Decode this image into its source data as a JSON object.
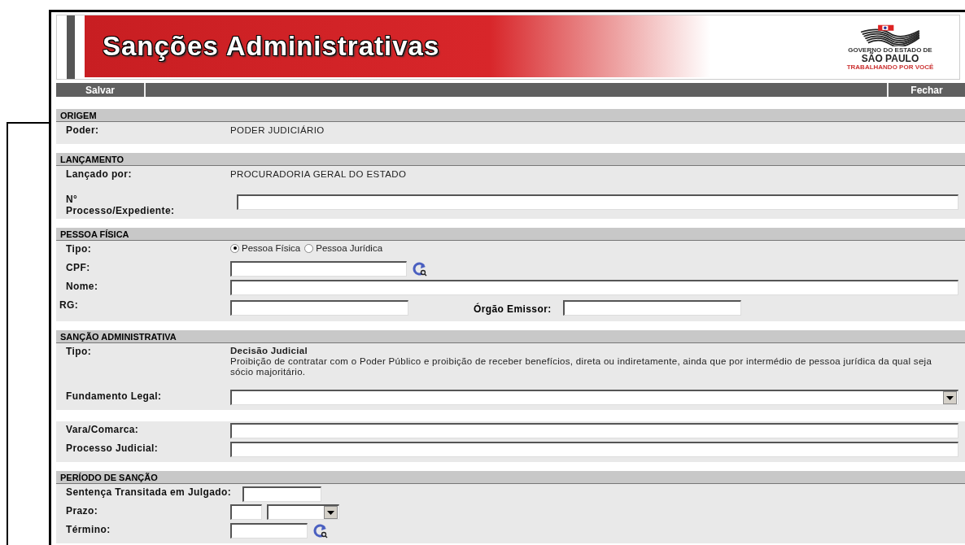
{
  "header": {
    "title": "Sanções Administrativas",
    "logo": {
      "line_1": "GOVERNO DO ESTADO DE",
      "line_2": "SÃO PAULO",
      "line_3": "TRABALHANDO POR VOCÊ"
    }
  },
  "toolbar": {
    "left_button": "Salvar",
    "right_button": "Fechar"
  },
  "sections": [
    {
      "title": "ORIGEM",
      "blocks": [
        {
          "rows": [
            {
              "kind": "text",
              "label": "Poder:",
              "value": "PODER JUDICIÁRIO"
            }
          ]
        }
      ]
    },
    {
      "title": "LANÇAMENTO",
      "blocks": [
        {
          "rows": [
            {
              "kind": "text",
              "label": "Lançado por:",
              "value": "PROCURADORIA GERAL DO ESTADO"
            },
            {
              "kind": "input_tall",
              "label": "N°\nProcesso/Expediente:"
            }
          ]
        }
      ]
    },
    {
      "title": "PESSOA FÍSICA",
      "blocks": [
        {
          "rows": [
            {
              "kind": "radio",
              "label": "Tipo:",
              "options": [
                {
                  "label": "Pessoa Física",
                  "selected": true
                },
                {
                  "label": "Pessoa Jurídica",
                  "selected": false
                }
              ]
            },
            {
              "kind": "lookup",
              "label": "CPF:"
            },
            {
              "kind": "input",
              "label": "Nome:"
            },
            {
              "kind": "pair",
              "label": "RG:",
              "second_label": "Órgão Emissor:"
            }
          ]
        }
      ]
    },
    {
      "title": "SANÇÃO ADMINISTRATIVA",
      "blocks": [
        {
          "rows": [
            {
              "kind": "description",
              "label": "Tipo:",
              "value_title": "Decisão Judicial",
              "value_text": "Proibição de contratar com o Poder Público e proibição de receber benefícios, direta ou indiretamente, ainda que por intermédio de pessoa jurídica da qual seja sócio majoritário."
            },
            {
              "kind": "select",
              "label": "Fundamento Legal:"
            }
          ]
        },
        {
          "rows": [
            {
              "kind": "input",
              "label": "Vara/Comarca:"
            },
            {
              "kind": "input",
              "label": "Processo Judicial:"
            }
          ]
        }
      ]
    },
    {
      "title": "PERÍODO DE SANÇÃO",
      "blocks": [
        {
          "rows": [
            {
              "kind": "inline_input",
              "label": "Sentença Transitada em Julgado:"
            },
            {
              "kind": "term",
              "label": "Prazo:"
            },
            {
              "kind": "date_lookup",
              "label": "Término:"
            }
          ]
        }
      ]
    }
  ]
}
